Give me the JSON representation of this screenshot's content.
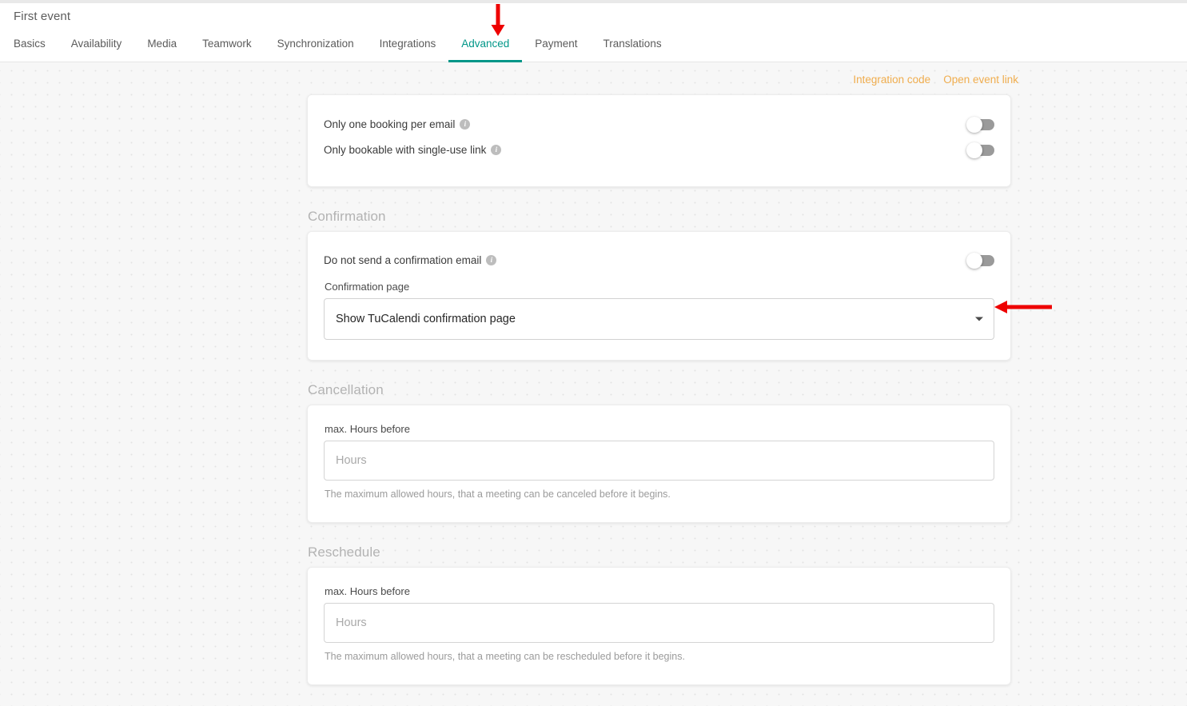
{
  "header": {
    "event_title": "First event",
    "tabs": [
      {
        "label": "Basics",
        "active": false
      },
      {
        "label": "Availability",
        "active": false
      },
      {
        "label": "Media",
        "active": false
      },
      {
        "label": "Teamwork",
        "active": false
      },
      {
        "label": "Synchronization",
        "active": false
      },
      {
        "label": "Integrations",
        "active": false
      },
      {
        "label": "Advanced",
        "active": true
      },
      {
        "label": "Payment",
        "active": false
      },
      {
        "label": "Translations",
        "active": false
      }
    ],
    "active_tab": "Advanced",
    "active_color": "#009688"
  },
  "toplinks": {
    "integration_code": "Integration code",
    "open_event_link": "Open event link",
    "color": "#f0ad4e"
  },
  "options_card": {
    "rows": [
      {
        "label": "Only one booking per email",
        "info": "i",
        "state": "off"
      },
      {
        "label": "Only bookable with single-use link",
        "info": "i",
        "state": "off"
      }
    ]
  },
  "confirmation": {
    "section_title": "Confirmation",
    "toggle_label": "Do not send a confirmation email",
    "toggle_info": "i",
    "toggle_state": "off",
    "select_label": "Confirmation page",
    "select_value": "Show TuCalendi confirmation page"
  },
  "cancellation": {
    "section_title": "Cancellation",
    "field_label": "max. Hours before",
    "input_value": "",
    "input_placeholder": "Hours",
    "hint": "The maximum allowed hours, that a meeting can be canceled before it begins."
  },
  "reschedule": {
    "section_title": "Reschedule",
    "field_label": "max. Hours before",
    "input_value": "",
    "input_placeholder": "Hours",
    "hint": "The maximum allowed hours, that a meeting can be rescheduled before it begins."
  },
  "annotations": {
    "color": "#ee0000",
    "arrow_down_target": "Advanced",
    "arrow_left_target": "Confirmation page select"
  }
}
